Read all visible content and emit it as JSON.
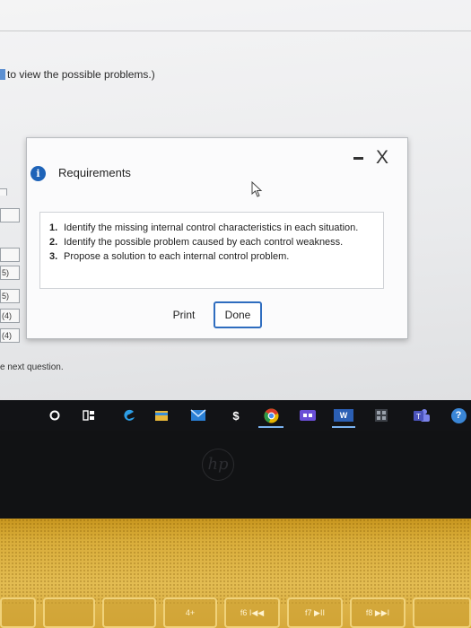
{
  "page": {
    "hint_text": "to view the possible problems.)",
    "next_question_text": "e next question.",
    "side_labels": [
      "",
      "",
      "",
      "5)",
      "5)",
      "(4)",
      "(4)"
    ]
  },
  "dialog": {
    "title": "Requirements",
    "info_icon": "i",
    "close_icon": "X",
    "requirements": [
      {
        "num": "1.",
        "text": "Identify the missing internal control characteristics in each situation."
      },
      {
        "num": "2.",
        "text": "Identify the possible problem caused by each control weakness."
      },
      {
        "num": "3.",
        "text": "Propose a solution to each internal control problem."
      }
    ],
    "print_label": "Print",
    "done_label": "Done"
  },
  "taskbar": {
    "icons": [
      "start-circle-icon",
      "task-view-icon",
      "edge-icon",
      "file-explorer-icon",
      "mail-icon",
      "money-app-icon",
      "chrome-icon",
      "video-app-icon",
      "word-icon",
      "calculator-icon",
      "teams-icon",
      "help-icon"
    ],
    "word_glyph": "W",
    "help_glyph": "?"
  },
  "hardware": {
    "logo_text": "hp",
    "fkeys": [
      "",
      "",
      "",
      "4+",
      "f6 I◀◀",
      "f7 ▶II",
      "f8 ▶▶I",
      ""
    ]
  },
  "colors": {
    "accent": "#2f6dbf",
    "info": "#1e63b8",
    "keyboard_gold": "#d9ad3a"
  }
}
